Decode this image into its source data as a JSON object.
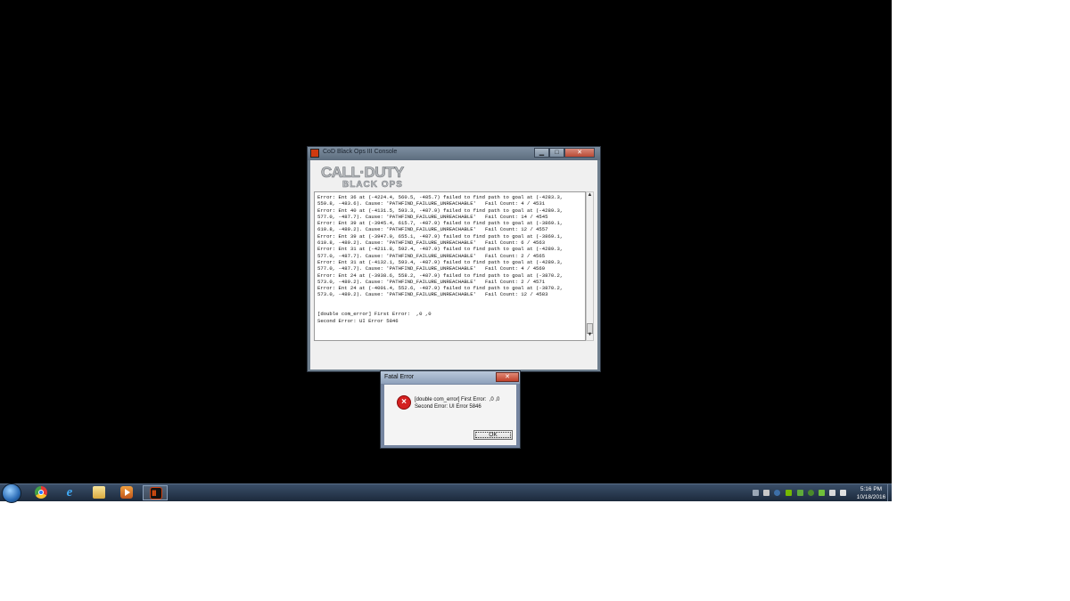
{
  "console": {
    "title": "CoD Black Ops III Console",
    "logo_line1": "CALL·DUTY",
    "logo_line2": "BLACK OPS",
    "log_lines": [
      "Error: Ent 36 at (-4224.4, 560.5, -485.7) failed to find path to goal at (-4283.3,",
      "559.8, -483.6). Cause: 'PATHFIND_FAILURE_UNREACHABLE'   Fail Count: 4 / 4531",
      "Error: Ent 40 at (-4131.5, 593.3, -487.9) failed to find path to goal at (-4289.3,",
      "577.0, -487.7). Cause: 'PATHFIND_FAILURE_UNREACHABLE'   Fail Count: 14 / 4545",
      "Error: Ent 39 at (-3945.4, 615.7, -487.9) failed to find path to goal at (-3869.1,",
      "610.8, -489.2). Cause: 'PATHFIND_FAILURE_UNREACHABLE'   Fail Count: 12 / 4557",
      "Error: Ent 39 at (-3947.9, 655.1, -487.9) failed to find path to goal at (-3869.1,",
      "610.8, -489.2). Cause: 'PATHFIND_FAILURE_UNREACHABLE'   Fail Count: 6 / 4563",
      "Error: Ent 31 at (-4211.8, 592.4, -487.9) failed to find path to goal at (-4289.3,",
      "577.0, -487.7). Cause: 'PATHFIND_FAILURE_UNREACHABLE'   Fail Count: 2 / 4565",
      "Error: Ent 31 at (-4132.1, 593.4, -487.9) failed to find path to goal at (-4289.3,",
      "577.0, -487.7). Cause: 'PATHFIND_FAILURE_UNREACHABLE'   Fail Count: 4 / 4569",
      "Error: Ent 24 at (-3938.6, 558.2, -487.9) failed to find path to goal at (-3870.2,",
      "573.0, -489.2). Cause: 'PATHFIND_FAILURE_UNREACHABLE'   Fail Count: 2 / 4571",
      "Error: Ent 24 at (-4001.4, 552.6, -487.9) failed to find path to goal at (-3870.2,",
      "573.0, -489.2). Cause: 'PATHFIND_FAILURE_UNREACHABLE'   Fail Count: 12 / 4583",
      "",
      "",
      "[double com_error] First Error:  ,0 ,0",
      "Second Error: UI Error 5846"
    ]
  },
  "fatal_error": {
    "title": "Fatal Error",
    "message_line1": "[double com_error] First Error:  ,0 ,0",
    "message_line2": "Second Error: UI Error 5846",
    "ok_label": "OK"
  },
  "taskbar": {
    "apps": [
      "start-orb",
      "chrome-icon",
      "internet-explorer-icon",
      "windows-explorer-icon",
      "media-player-icon",
      "black-ops-3-icon"
    ],
    "clock_time": "5:16 PM",
    "clock_date": "10/18/2016"
  },
  "colors": {
    "desktop": "#000000",
    "taskbar": "#1c2a3c",
    "error_red": "#d42020"
  }
}
